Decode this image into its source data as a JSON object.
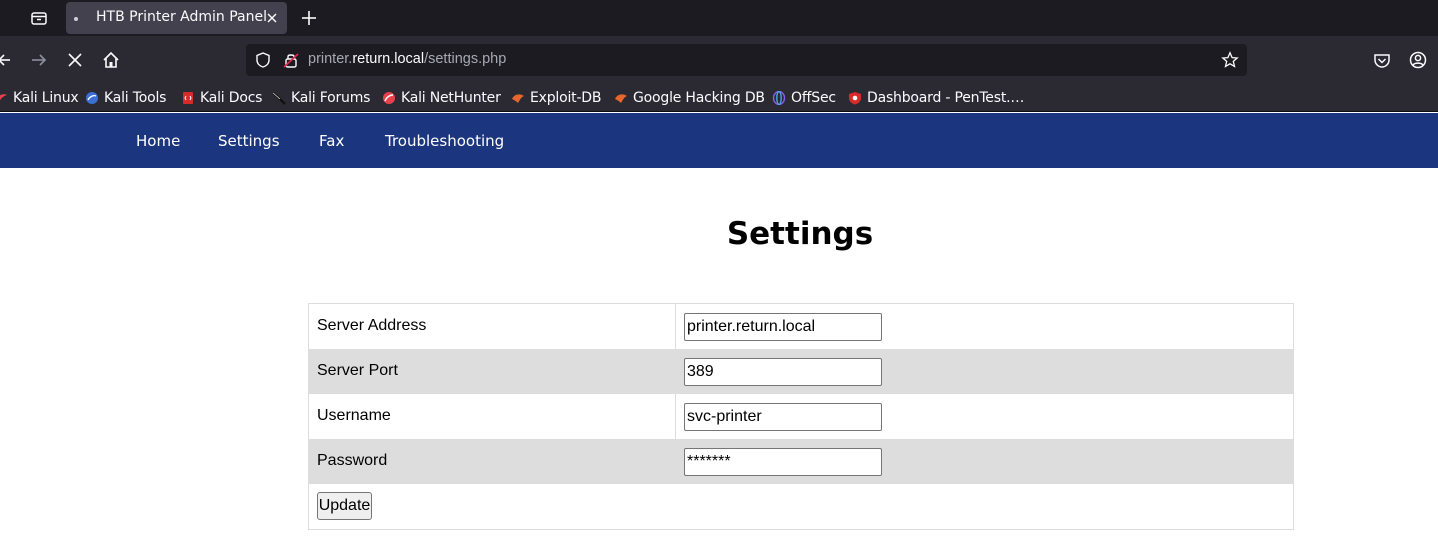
{
  "browser": {
    "tab_title": "HTB Printer Admin Panel",
    "url_host_prefix": "printer.",
    "url_host": "return.local",
    "url_path": "/settings.php",
    "bookmarks": [
      {
        "label": "Kali Linux",
        "icon": "kali-icon"
      },
      {
        "label": "Kali Tools",
        "icon": "kali-tools-icon"
      },
      {
        "label": "Kali Docs",
        "icon": "kali-docs-icon"
      },
      {
        "label": "Kali Forums",
        "icon": "kali-forums-icon"
      },
      {
        "label": "Kali NetHunter",
        "icon": "nethunter-icon"
      },
      {
        "label": "Exploit-DB",
        "icon": "exploit-db-icon"
      },
      {
        "label": "Google Hacking DB",
        "icon": "ghdb-icon"
      },
      {
        "label": "OffSec",
        "icon": "offsec-icon"
      },
      {
        "label": "Dashboard - PenTest.…",
        "icon": "pentest-icon"
      }
    ]
  },
  "site_nav": {
    "items": [
      {
        "label": "Home"
      },
      {
        "label": "Settings"
      },
      {
        "label": "Fax"
      },
      {
        "label": "Troubleshooting"
      }
    ]
  },
  "page": {
    "title": "Settings",
    "fields": [
      {
        "label": "Server Address",
        "value": "printer.return.local"
      },
      {
        "label": "Server Port",
        "value": "389"
      },
      {
        "label": "Username",
        "value": "svc-printer"
      },
      {
        "label": "Password",
        "value": "*******"
      }
    ],
    "update_label": "Update"
  },
  "colors": {
    "site_nav_bg": "#1b367f",
    "row_alt_bg": "#dddddd",
    "browser_bg": "#2b2a33"
  }
}
